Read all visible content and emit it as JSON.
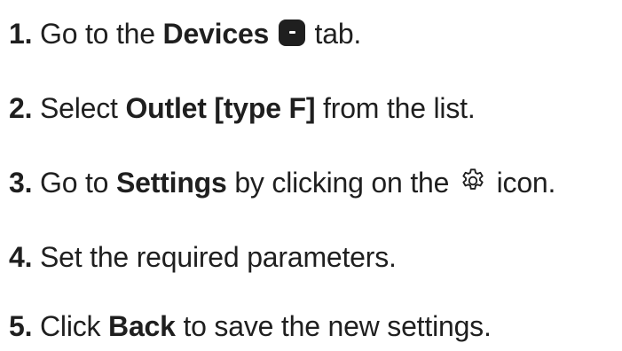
{
  "steps": [
    {
      "num": "1.",
      "before": "Go to the",
      "bold": "Devices",
      "after": "tab."
    },
    {
      "num": "2.",
      "before": "Select",
      "bold": "Outlet [type F]",
      "after": "from the list."
    },
    {
      "num": "3.",
      "before": "Go to",
      "bold": "Settings",
      "middle": "by clicking on the",
      "after": "icon."
    },
    {
      "num": "4.",
      "text": "Set the required parameters."
    },
    {
      "num": "5.",
      "before": "Click",
      "bold": "Back",
      "after": "to save the new settings."
    }
  ],
  "icons": {
    "devices": "devices-icon",
    "settings": "gear-icon"
  }
}
